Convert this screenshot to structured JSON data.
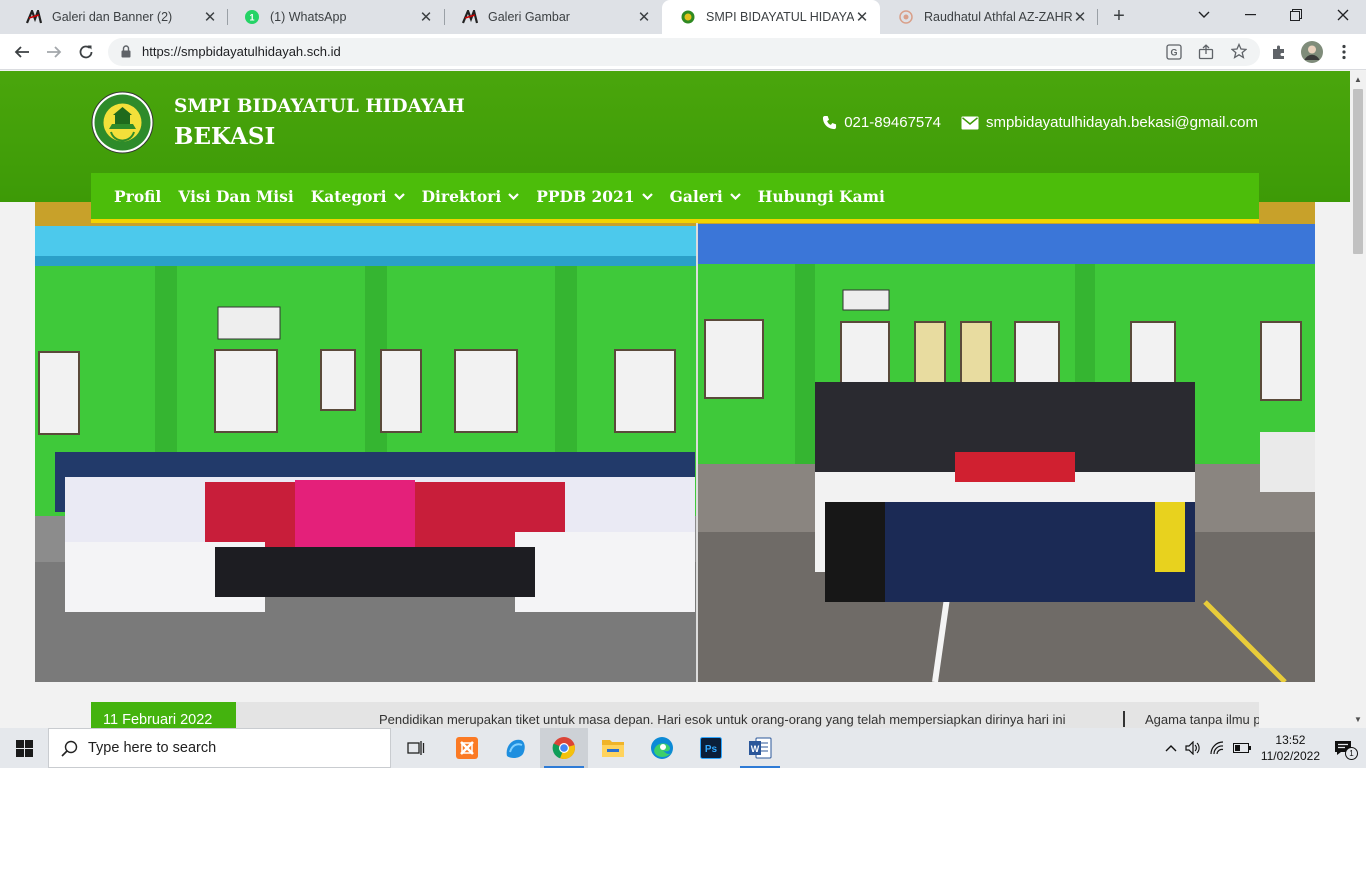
{
  "browser": {
    "tabs": [
      {
        "title": "Galeri dan Banner (2)",
        "icon": "site-logo-icon"
      },
      {
        "title": "(1) WhatsApp",
        "icon": "whatsapp-icon"
      },
      {
        "title": "Galeri Gambar",
        "icon": "site-logo-icon"
      },
      {
        "title": "SMPI BIDAYATUL HIDAYAH BEKASI",
        "icon": "school-emblem-icon",
        "active": true
      },
      {
        "title": "Raudhatul Athfal AZ-ZAHRA",
        "icon": "school-emblem-icon"
      }
    ],
    "url": "https://smpbidayatulhidayah.sch.id"
  },
  "site": {
    "title": "SMPI BIDAYATUL HIDAYAH",
    "subtitle": "BEKASI",
    "phone": "021-89467574",
    "email": "smpbidayatulhidayah.bekasi@gmail.com",
    "brand_color": "#45a30b",
    "nav_color": "#4cbd0a",
    "accent_color": "#f3d400"
  },
  "nav": {
    "items": [
      {
        "label": "Profil",
        "dropdown": false
      },
      {
        "label": "Visi Dan Misi",
        "dropdown": false
      },
      {
        "label": "Kategori",
        "dropdown": true
      },
      {
        "label": "Direktori",
        "dropdown": true
      },
      {
        "label": "PPDB 2021",
        "dropdown": true
      },
      {
        "label": "Galeri",
        "dropdown": true
      },
      {
        "label": "Hubungi Kami",
        "dropdown": false
      }
    ]
  },
  "ticker": {
    "date": "11 Februari 2022",
    "text": "Pendidikan merupakan tiket untuk masa depan. Hari esok untuk orang-orang yang telah mempersiapkan dirinya hari ini",
    "text2": "Agama tanpa ilmu p"
  },
  "taskbar": {
    "search_placeholder": "Type here to search",
    "time": "13:52",
    "date": "11/02/2022",
    "notifications": "1"
  }
}
